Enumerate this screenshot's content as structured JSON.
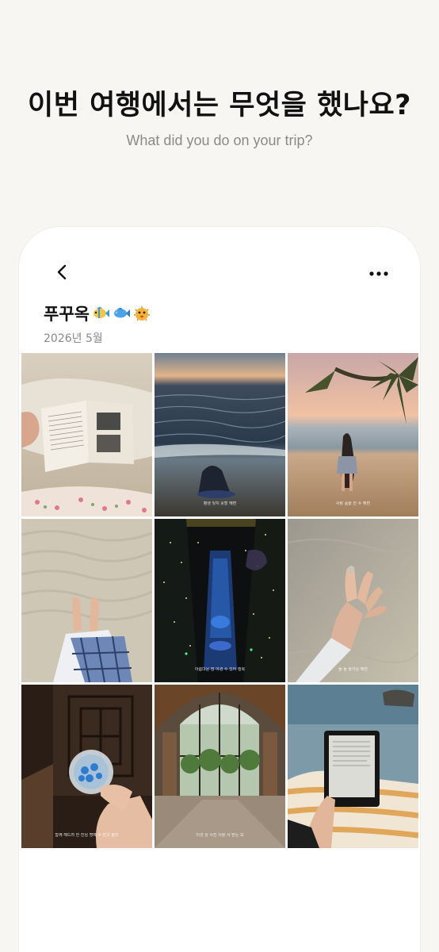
{
  "hero": {
    "title": "이번 여행에서는 무엇을 했나요?",
    "subtitle": "What did you do on your trip?"
  },
  "album": {
    "title": "푸꾸옥",
    "emoji": [
      "tropical-fish",
      "fish",
      "blowfish"
    ],
    "date": "2026년 5월"
  },
  "icons": {
    "back": "chevron-left-icon",
    "more": "more-horizontal-icon"
  },
  "colors": {
    "background": "#f7f6f3",
    "card": "#ffffff",
    "title": "#111111",
    "subtitle": "#8a8a8a"
  },
  "photos": [
    {
      "id": "book-on-bed",
      "caption": ""
    },
    {
      "id": "beach-sunset-waves",
      "caption": "평생 잊지 못할 해변"
    },
    {
      "id": "palm-beach-girl",
      "caption": "사랑 품을 한 수 해변"
    },
    {
      "id": "feet-on-sand",
      "caption": ""
    },
    {
      "id": "night-pool-lights",
      "caption": "아름다운 밤 야경 수 있어 행복"
    },
    {
      "id": "hand-in-water",
      "caption": "물 돌 즐거운 해변"
    },
    {
      "id": "hand-glass-jewels",
      "caption": "함께 해드려 한 진심 명예 수 만고 울리"
    },
    {
      "id": "resort-lobby",
      "caption": "이것 상 사진 사랑 사 받는 모"
    },
    {
      "id": "kindle-by-pool",
      "caption": ""
    }
  ]
}
